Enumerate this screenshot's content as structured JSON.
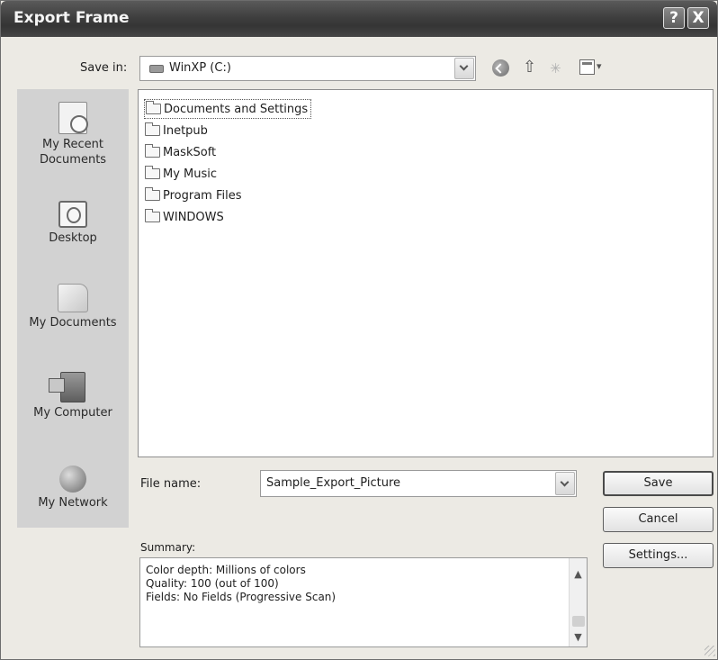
{
  "dialog": {
    "title": "Export Frame",
    "help_button": "?",
    "close_button": "X"
  },
  "save_in": {
    "label": "Save in:",
    "value": "WinXP (C:)"
  },
  "toolbar": {
    "icons": [
      "back-icon",
      "up-folder-icon",
      "new-folder-icon",
      "view-menu-icon"
    ]
  },
  "places": [
    {
      "label": "My Recent Documents",
      "icon": "recent-documents-icon"
    },
    {
      "label": "Desktop",
      "icon": "desktop-icon"
    },
    {
      "label": "My Documents",
      "icon": "my-documents-icon"
    },
    {
      "label": "My Computer",
      "icon": "my-computer-icon"
    },
    {
      "label": "My Network",
      "icon": "my-network-icon"
    }
  ],
  "files": [
    {
      "name": "Documents and Settings",
      "selected": true
    },
    {
      "name": "Inetpub",
      "selected": false
    },
    {
      "name": "MaskSoft",
      "selected": false
    },
    {
      "name": "My Music",
      "selected": false
    },
    {
      "name": "Program Files",
      "selected": false
    },
    {
      "name": "WINDOWS",
      "selected": false
    }
  ],
  "file_name": {
    "label": "File name:",
    "value": "Sample_Export_Picture"
  },
  "buttons": {
    "save": "Save",
    "cancel": "Cancel",
    "settings": "Settings..."
  },
  "summary": {
    "label": "Summary:",
    "lines": [
      "Color depth: Millions of colors",
      "Quality: 100 (out of 100)",
      "Fields: No Fields (Progressive Scan)"
    ]
  }
}
